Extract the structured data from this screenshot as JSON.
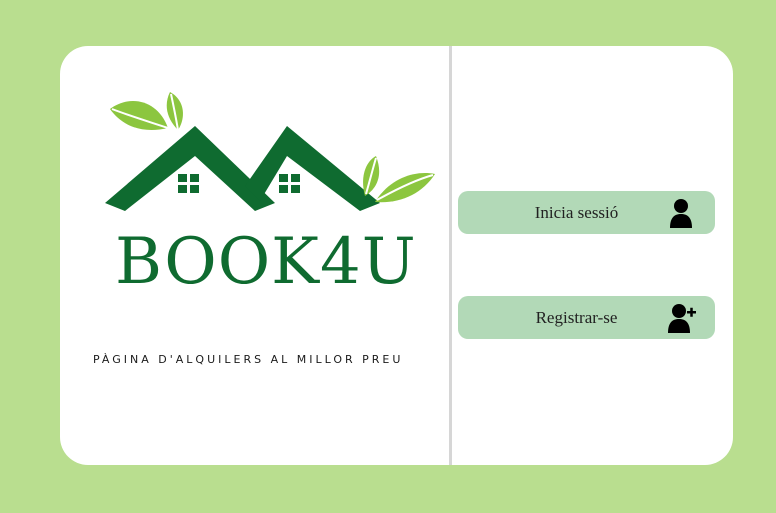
{
  "brand": {
    "name": "BOOK4U",
    "tagline": "PÀGINA D'ALQUILERS AL MILLOR PREU"
  },
  "actions": {
    "login_label": "Inicia sessió",
    "register_label": "Registrar-se"
  },
  "icons": {
    "login": "user-icon",
    "register": "user-plus-icon"
  },
  "colors": {
    "background": "#b9de8f",
    "brand_green": "#0f6b30",
    "leaf_green": "#8cc63f",
    "button": "#b2d9b7"
  }
}
